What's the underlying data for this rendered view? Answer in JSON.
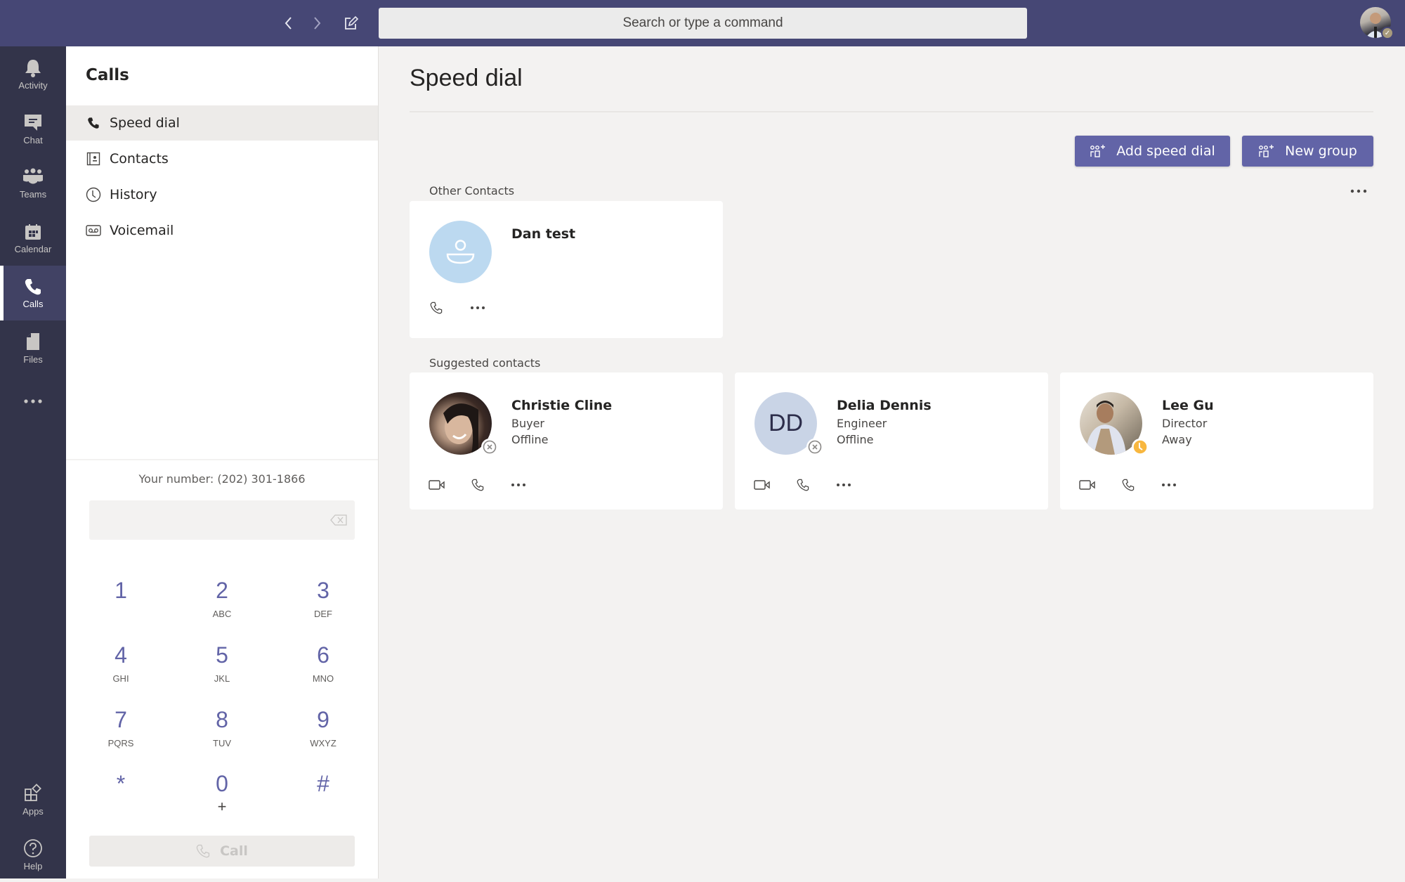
{
  "topbar": {
    "back_icon": "chevron-left-icon",
    "forward_icon": "chevron-right-icon",
    "compose_icon": "compose-icon",
    "search_placeholder": "Search or type a command",
    "profile_status": "available"
  },
  "rail": {
    "items": [
      {
        "label": "Activity",
        "icon": "bell-icon"
      },
      {
        "label": "Chat",
        "icon": "chat-icon"
      },
      {
        "label": "Teams",
        "icon": "teams-icon"
      },
      {
        "label": "Calendar",
        "icon": "calendar-icon"
      },
      {
        "label": "Calls",
        "icon": "phone-icon",
        "active": true
      },
      {
        "label": "Files",
        "icon": "file-icon"
      },
      {
        "label": "",
        "icon": "more-icon"
      }
    ],
    "bottom": [
      {
        "label": "Apps",
        "icon": "apps-icon"
      },
      {
        "label": "Help",
        "icon": "help-icon"
      }
    ]
  },
  "panel": {
    "title": "Calls",
    "items": [
      {
        "label": "Speed dial",
        "icon": "phone-icon",
        "active": true
      },
      {
        "label": "Contacts",
        "icon": "contact-card-icon"
      },
      {
        "label": "History",
        "icon": "clock-icon"
      },
      {
        "label": "Voicemail",
        "icon": "voicemail-icon"
      }
    ],
    "your_number": "Your number: (202) 301-1866",
    "dial_value": "",
    "keys": [
      {
        "digit": "1",
        "letters": ""
      },
      {
        "digit": "2",
        "letters": "ABC"
      },
      {
        "digit": "3",
        "letters": "DEF"
      },
      {
        "digit": "4",
        "letters": "GHI"
      },
      {
        "digit": "5",
        "letters": "JKL"
      },
      {
        "digit": "6",
        "letters": "MNO"
      },
      {
        "digit": "7",
        "letters": "PQRS"
      },
      {
        "digit": "8",
        "letters": "TUV"
      },
      {
        "digit": "9",
        "letters": "WXYZ"
      },
      {
        "digit": "*",
        "letters": ""
      },
      {
        "digit": "0",
        "letters": "+"
      },
      {
        "digit": "#",
        "letters": ""
      }
    ],
    "call_label": "Call"
  },
  "main": {
    "title": "Speed dial",
    "add_speed_dial_label": "Add speed dial",
    "new_group_label": "New group",
    "other_contacts_label": "Other Contacts",
    "suggested_contacts_label": "Suggested contacts",
    "other_contacts": [
      {
        "name": "Dan test",
        "role": "",
        "status": "",
        "avatar": "default-person",
        "avatar_color": "#bcd9f0"
      }
    ],
    "suggested_contacts": [
      {
        "name": "Christie Cline",
        "role": "Buyer",
        "status": "Offline",
        "avatar": "photo",
        "presence": "offline"
      },
      {
        "name": "Delia Dennis",
        "role": "Engineer",
        "status": "Offline",
        "avatar": "initials",
        "initials": "DD",
        "avatar_color": "#c9d4e6",
        "presence": "offline"
      },
      {
        "name": "Lee Gu",
        "role": "Director",
        "status": "Away",
        "avatar": "photo",
        "presence": "away"
      }
    ]
  },
  "colors": {
    "brand": "#6264a7",
    "topbar": "#464775",
    "rail": "#33344a",
    "away": "#f8b73f",
    "offline": "#8a8886"
  }
}
